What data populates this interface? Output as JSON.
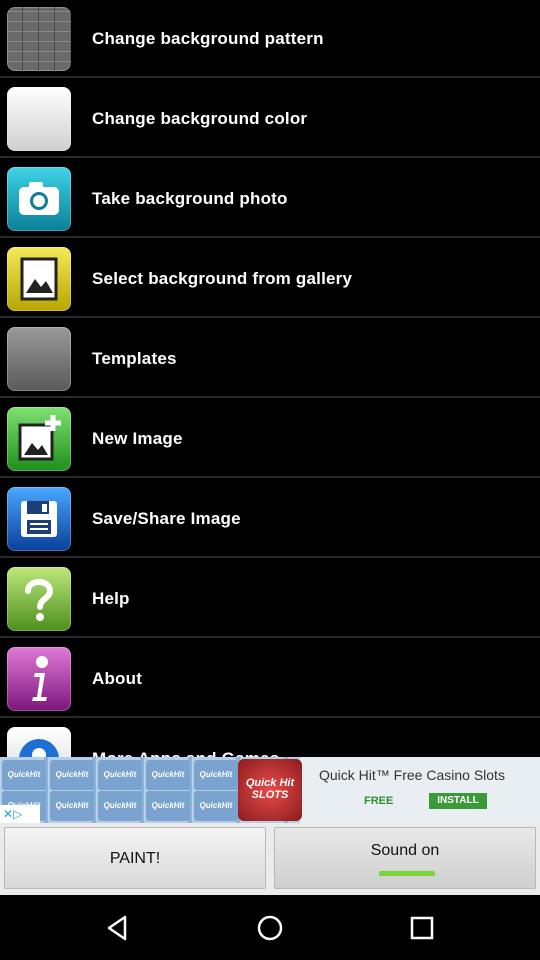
{
  "menu": {
    "items": [
      {
        "label": "Change background pattern",
        "icon": "brick-pattern-icon"
      },
      {
        "label": "Change background color",
        "icon": "color-swatch-icon"
      },
      {
        "label": "Take background photo",
        "icon": "camera-icon"
      },
      {
        "label": "Select background from gallery",
        "icon": "gallery-icon"
      },
      {
        "label": "Templates",
        "icon": "templates-icon"
      },
      {
        "label": "New Image",
        "icon": "new-image-icon"
      },
      {
        "label": "Save/Share Image",
        "icon": "floppy-disk-icon"
      },
      {
        "label": "Help",
        "icon": "question-mark-icon"
      },
      {
        "label": "About",
        "icon": "info-icon"
      },
      {
        "label": "More Apps and Games",
        "icon": "more-apps-icon"
      }
    ]
  },
  "ad": {
    "title": "Quick Hit™ Free Casino Slots",
    "free": "FREE",
    "install": "INSTALL",
    "tile_text": "QuickHit",
    "logo_text": "Quick Hit SLOTS",
    "close": "✕▷"
  },
  "bottom": {
    "paint_label": "PAINT!",
    "sound_label": "Sound on",
    "sound_indicator_color": "#7ad43b"
  },
  "nav": {
    "back": "back-icon",
    "home": "home-icon",
    "recents": "recents-icon"
  }
}
